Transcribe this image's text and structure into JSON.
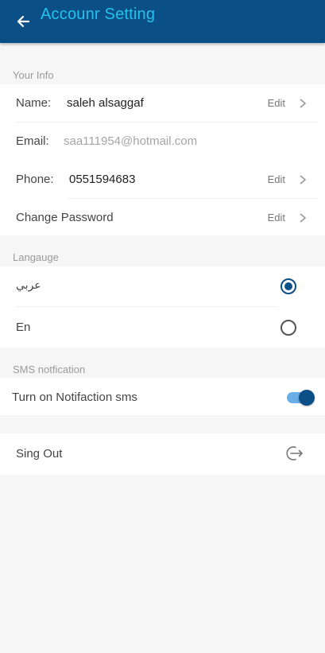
{
  "appbar": {
    "title": "Accounr Setting",
    "back_icon": "arrow-left-icon",
    "background": "#0a4f86",
    "title_color": "#25c2ee"
  },
  "your_info": {
    "section_label": "Your Info",
    "name": {
      "label": "Name:",
      "value": "saleh alsaggaf",
      "edit": "Edit"
    },
    "email": {
      "label": "Email:",
      "value": "saa111954@hotmail.com"
    },
    "phone": {
      "label": "Phone:",
      "value": "0551594683",
      "edit": "Edit"
    },
    "password": {
      "label": "Change Password",
      "edit": "Edit"
    }
  },
  "language": {
    "section_label": "Langauge",
    "options": [
      {
        "label": "عربي",
        "selected": true
      },
      {
        "label": "En",
        "selected": false
      }
    ]
  },
  "sms": {
    "section_label": "SMS notfication",
    "toggle_label": "Turn on Notifaction sms",
    "enabled": true
  },
  "signout": {
    "label": "Sing Out",
    "icon": "logout-icon"
  },
  "colors": {
    "accent": "#0a4f86",
    "toggle_track": "#6aaee8"
  }
}
